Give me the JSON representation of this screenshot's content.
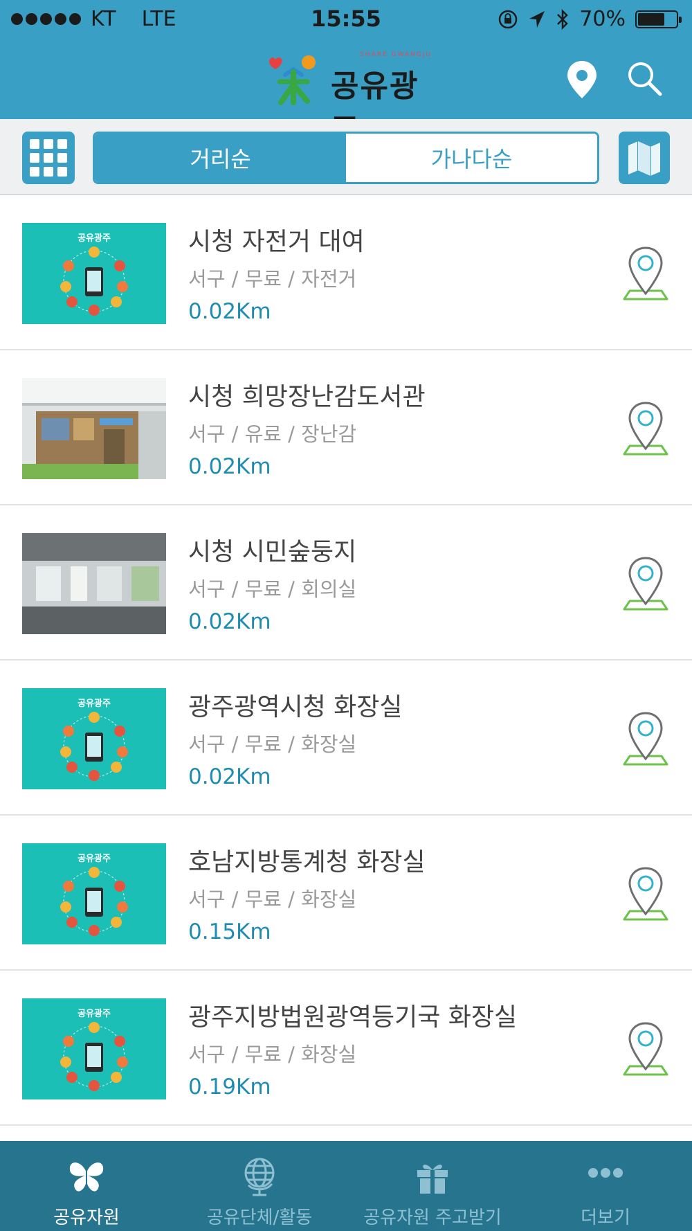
{
  "status_bar": {
    "carrier": "KT",
    "network": "LTE",
    "time": "15:55",
    "battery": "70%",
    "battery_level": 0.7,
    "icons": [
      "signal-dots-icon",
      "orientation-lock-icon",
      "location-arrow-icon",
      "bluetooth-icon",
      "battery-icon"
    ]
  },
  "header": {
    "logo_text": "공유광주",
    "logo_tagline": "SHARE GWANGJU",
    "icons": [
      "location-pin-icon",
      "search-icon"
    ]
  },
  "toolbar": {
    "sort_options": [
      {
        "label": "거리순",
        "selected": true
      },
      {
        "label": "가나다순",
        "selected": false
      }
    ],
    "icons": [
      "grid-menu-icon",
      "map-icon"
    ]
  },
  "list": {
    "items": [
      {
        "title": "시청 자전거 대여",
        "meta": "서구 / 무료 / 자전거",
        "distance": "0.02Km",
        "thumbnail": "share-gwangju-default-thumbnail"
      },
      {
        "title": "시청 희망장난감도서관",
        "meta": "서구 / 유료 / 장난감",
        "distance": "0.02Km",
        "thumbnail": "toy-library-photo"
      },
      {
        "title": "시청 시민숲둥지",
        "meta": "서구 / 무료 / 회의실",
        "distance": "0.02Km",
        "thumbnail": "meeting-room-photo"
      },
      {
        "title": "광주광역시청 화장실",
        "meta": "서구 / 무료 / 화장실",
        "distance": "0.02Km",
        "thumbnail": "share-gwangju-default-thumbnail"
      },
      {
        "title": "호남지방통계청 화장실",
        "meta": "서구 / 무료 / 화장실",
        "distance": "0.15Km",
        "thumbnail": "share-gwangju-default-thumbnail"
      },
      {
        "title": "광주지방법원광역등기국 화장실",
        "meta": "서구 / 무료 / 화장실",
        "distance": "0.19Km",
        "thumbnail": "share-gwangju-default-thumbnail"
      }
    ]
  },
  "tab_bar": {
    "tabs": [
      {
        "label": "공유자원",
        "icon": "butterfly-icon",
        "active": true
      },
      {
        "label": "공유단체/활동",
        "icon": "globe-icon",
        "active": false
      },
      {
        "label": "공유자원 주고받기",
        "icon": "gift-icon",
        "active": false
      },
      {
        "label": "더보기",
        "icon": "more-dots-icon",
        "active": false
      }
    ]
  },
  "colors": {
    "primary": "#3a9fc4",
    "tab_bar": "#27748e",
    "distance_text": "#1f8cb3",
    "pin_green": "#6cc24a",
    "pin_cyan": "#2fb3d1",
    "thumbnail_teal": "#1bbfb5"
  }
}
